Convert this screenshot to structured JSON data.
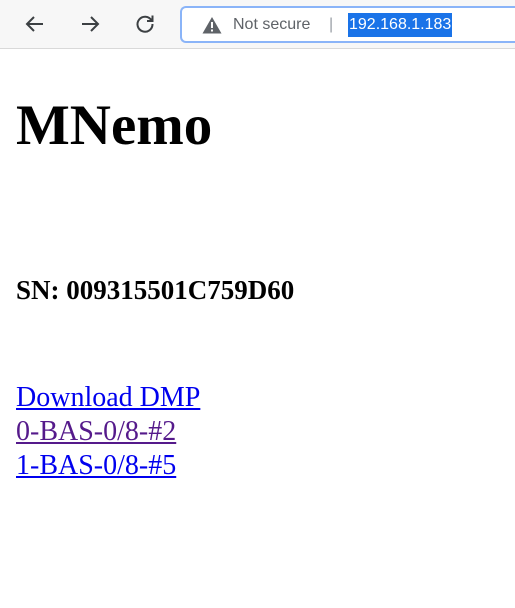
{
  "browser": {
    "security_label": "Not secure",
    "separator": "|",
    "url": "192.168.1.183"
  },
  "page": {
    "title": "MNemo",
    "serial": "SN: 009315501C759D60",
    "links": [
      {
        "label": "Download DMP",
        "visited": false
      },
      {
        "label": "0-BAS-0/8-#2",
        "visited": true
      },
      {
        "label": "1-BAS-0/8-#5",
        "visited": false
      }
    ]
  },
  "colors": {
    "link": "#0000ee",
    "visited_link": "#551a8b",
    "url_selection": "#1a73e8",
    "address_border": "#8ab4f8"
  },
  "icons": {
    "back": "back-arrow-icon",
    "forward": "forward-arrow-icon",
    "reload": "reload-icon",
    "security": "warning-triangle-icon"
  }
}
